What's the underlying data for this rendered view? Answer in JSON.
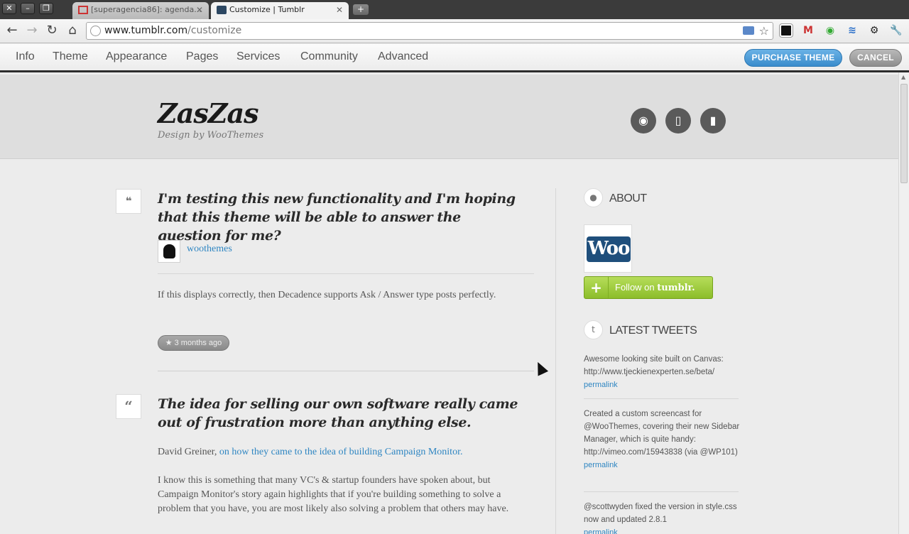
{
  "browser": {
    "tabs": [
      {
        "title": "[superagencia86]: agenda..."
      },
      {
        "title": "Customize | Tumblr"
      }
    ],
    "new_tab_label": "+",
    "url_host": "www.tumblr.com",
    "url_path": "/customize"
  },
  "customize_bar": {
    "tabs": [
      "Info",
      "Theme",
      "Appearance",
      "Pages",
      "Services",
      "Community",
      "Advanced"
    ],
    "purchase_label": "PURCHASE THEME",
    "cancel_label": "CANCEL"
  },
  "blog": {
    "title": "ZasZas",
    "subtitle": "Design by WooThemes",
    "header_icons": [
      "rss-icon",
      "devices-icon",
      "mobile-icon"
    ]
  },
  "posts": [
    {
      "type_icon": "chat-bubble-icon",
      "title": "I'm testing this new functionality and I'm hoping that this theme will be able to answer the question for me?",
      "author": "woothemes",
      "body": "If this displays correctly, then Decadence supports Ask / Answer type posts perfectly.",
      "date": "3 months ago"
    },
    {
      "type_icon": "quote-icon",
      "title": "The idea for selling our own software really came out of frustration more than anything else.",
      "lead_author": "David Greiner,",
      "lead_link": "on how they came to the idea of building Campaign Monitor.",
      "body": "I know this is something that many VC's & startup founders have spoken about, but Campaign Monitor's story again highlights that if you're building something to solve a problem that you have, you are most likely also solving a problem that others may have."
    }
  ],
  "sidebar": {
    "about_title": "ABOUT",
    "logo_text": "Woo",
    "follow_prefix": "Follow on",
    "follow_brand": "tumblr.",
    "tweets_title": "LATEST TWEETS",
    "tweets": [
      {
        "text": "Awesome looking site built on Canvas: http://www.tjeckienexperten.se/beta/",
        "permalink": "permalink"
      },
      {
        "text": "Created a custom screencast for @WooThemes, covering their new Sidebar Manager, which is quite handy: http://vimeo.com/15943838 (via @WP101)",
        "permalink": "permalink"
      },
      {
        "text": "@scottwyden fixed the version in style.css now and updated 2.8.1",
        "permalink": "permalink"
      }
    ]
  }
}
